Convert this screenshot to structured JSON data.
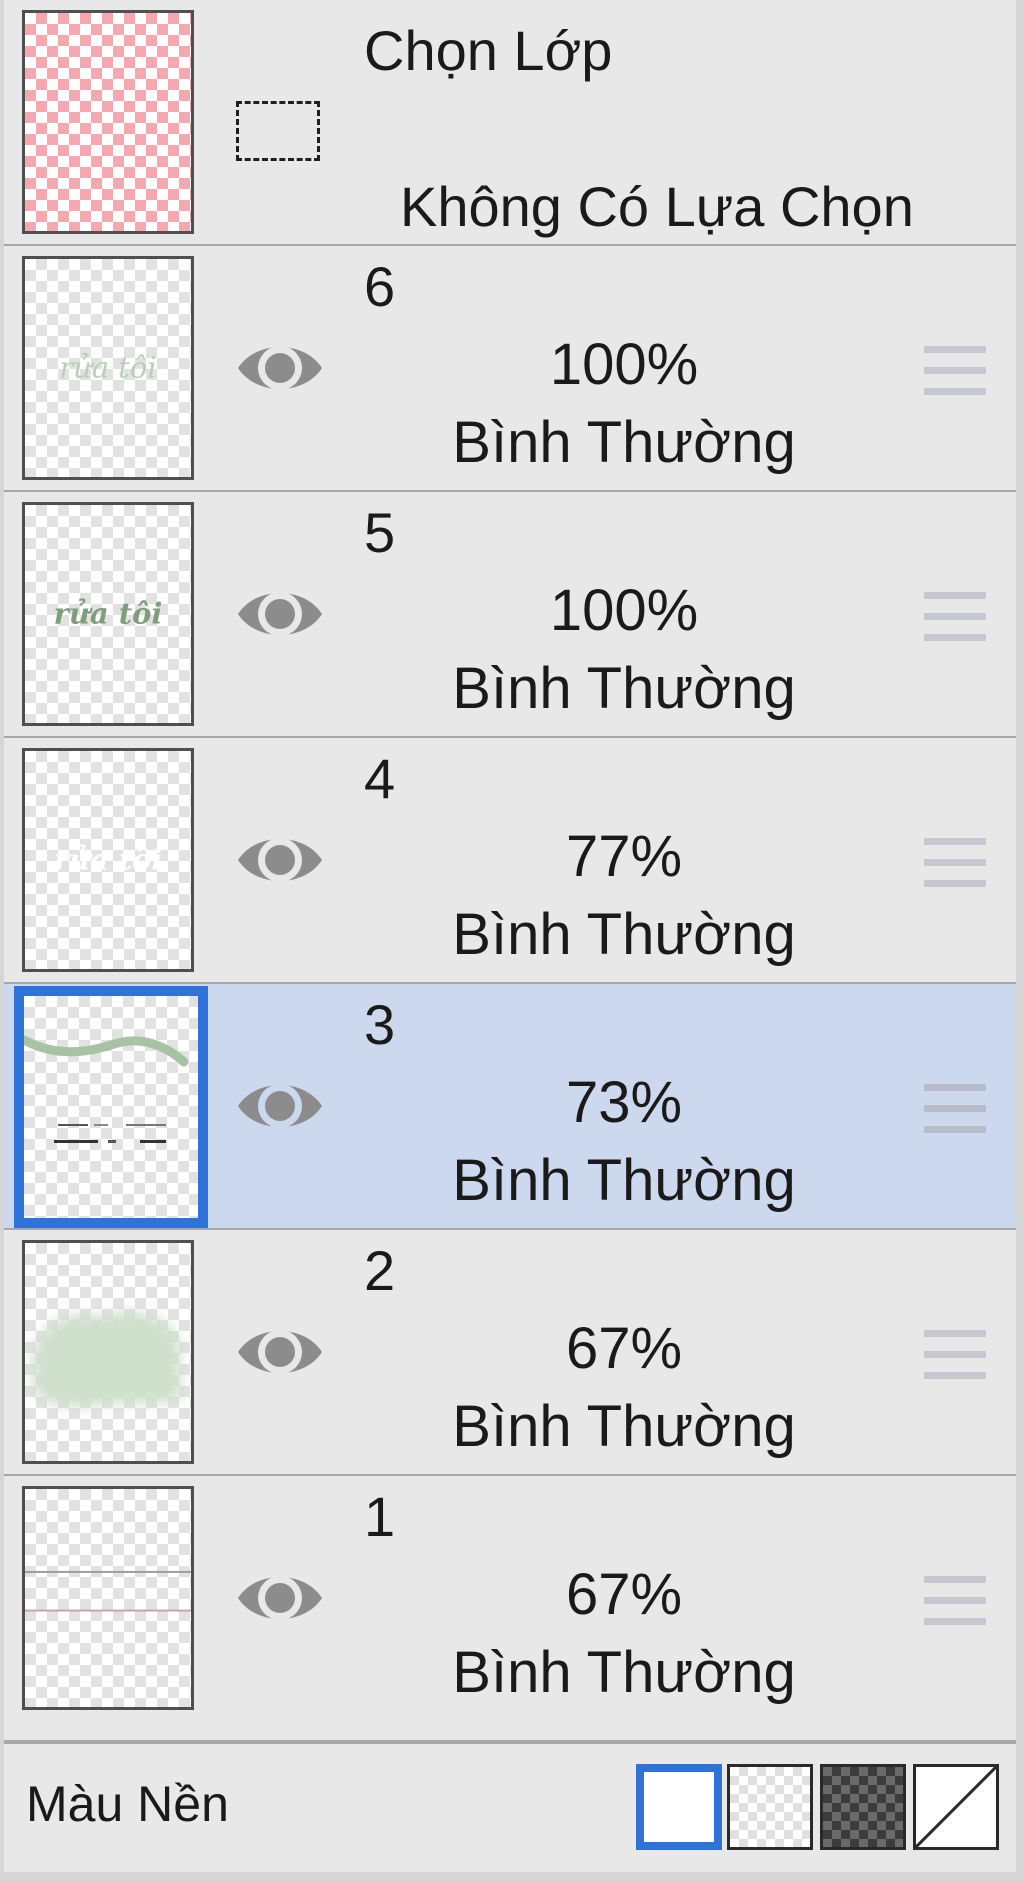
{
  "selection_layer": {
    "title": "Chọn Lớp",
    "status": "Không Có Lựa Chọn",
    "icon": "dashed-selection-rectangle"
  },
  "layers": [
    {
      "name": "6",
      "opacity": "100%",
      "blend_mode": "Bình Thường",
      "visible": true,
      "selected": false,
      "thumbnail_text": "rửa tôi"
    },
    {
      "name": "5",
      "opacity": "100%",
      "blend_mode": "Bình Thường",
      "visible": true,
      "selected": false,
      "thumbnail_text": "rửa tôi"
    },
    {
      "name": "4",
      "opacity": "77%",
      "blend_mode": "Bình Thường",
      "visible": true,
      "selected": false,
      "thumbnail_text": "rửa tôi"
    },
    {
      "name": "3",
      "opacity": "73%",
      "blend_mode": "Bình Thường",
      "visible": true,
      "selected": true
    },
    {
      "name": "2",
      "opacity": "67%",
      "blend_mode": "Bình Thường",
      "visible": true,
      "selected": false
    },
    {
      "name": "1",
      "opacity": "67%",
      "blend_mode": "Bình Thường",
      "visible": true,
      "selected": false
    }
  ],
  "background": {
    "label": "Màu Nền",
    "options": [
      "white",
      "checker",
      "dark-checker",
      "none"
    ],
    "selected": "white"
  },
  "colors": {
    "selected_row": "#cbd8ee",
    "selection_accent": "#2f72d8",
    "panel_bg": "#e8e8e8",
    "eye_icon": "#8c8c8c",
    "handle": "#c7c7d1",
    "thumb_text_green": "#8fae8a"
  }
}
